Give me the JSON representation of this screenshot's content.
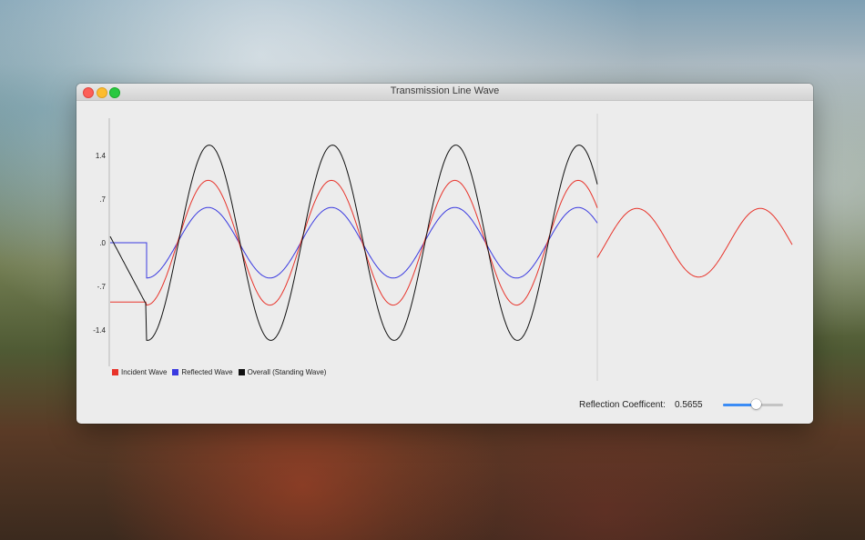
{
  "window": {
    "title": "Transmission Line Wave"
  },
  "chart_data": {
    "type": "line",
    "yticks": [
      "1.4",
      ".7",
      ".0",
      "-.7",
      "-1.4"
    ],
    "ytick_values": [
      1.4,
      0.7,
      0,
      -0.7,
      -1.4
    ],
    "ylim": [
      -1.9,
      1.9
    ],
    "series": [
      {
        "name": "Incident Wave",
        "color": "#e8332a"
      },
      {
        "name": "Reflected Wave",
        "color": "#3a3ae0"
      },
      {
        "name": "Overall (Standing Wave)",
        "color": "#111111"
      }
    ],
    "incident_amplitude": 1.0,
    "reflected_amplitude": 0.5655,
    "standing_amplitude": 1.5655
  },
  "footer": {
    "coefficient_label": "Reflection Coefficent:",
    "coefficient_value": "0.5655",
    "slider_value": 0.5655
  },
  "colors": {
    "incident": "#e8332a",
    "reflected": "#3a3ae0",
    "overall": "#111111",
    "accent": "#3b8cf5"
  }
}
